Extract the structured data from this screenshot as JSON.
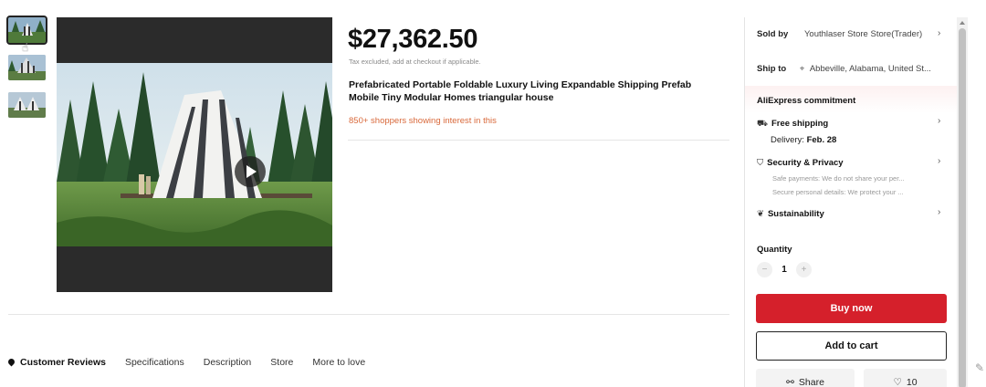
{
  "product": {
    "price": "$27,362.50",
    "tax_note": "Tax excluded, add at checkout if applicable.",
    "title": "Prefabricated Portable Foldable Luxury Living Expandable Shipping Prefab Mobile Tiny Modular Homes triangular house",
    "interest": "850+ shoppers showing interest in this"
  },
  "gallery": {
    "thumbnails": [
      "thumb-1",
      "thumb-2",
      "thumb-3"
    ],
    "active_index": 0,
    "icons": {
      "play": "play-icon"
    }
  },
  "tabs": [
    {
      "label": "Customer Reviews",
      "active": true,
      "icon": "location-pin-icon"
    },
    {
      "label": "Specifications"
    },
    {
      "label": "Description"
    },
    {
      "label": "Store"
    },
    {
      "label": "More to love"
    }
  ],
  "panel": {
    "sold_by_label": "Sold by",
    "sold_by_value": "Youthlaser Store Store(Trader)",
    "ship_to_label": "Ship to",
    "ship_to_value": "Abbeville, Alabama, United St...",
    "commitment_title": "AliExpress commitment",
    "free_shipping": "Free shipping",
    "delivery_label": "Delivery:",
    "delivery_date": "Feb. 28",
    "security_title": "Security & Privacy",
    "security_line1": "Safe payments: We do not share your per...",
    "security_line2": "Secure personal details: We protect your ...",
    "sustainability": "Sustainability",
    "quantity_label": "Quantity",
    "quantity_value": "1",
    "minus": "−",
    "plus": "+",
    "buy_now": "Buy now",
    "add_to_cart": "Add to cart",
    "share": "Share",
    "wishlist_count": "10",
    "chevron": "›"
  },
  "colors": {
    "buy_button": "#d5202b",
    "interest_text": "#d9693b"
  }
}
